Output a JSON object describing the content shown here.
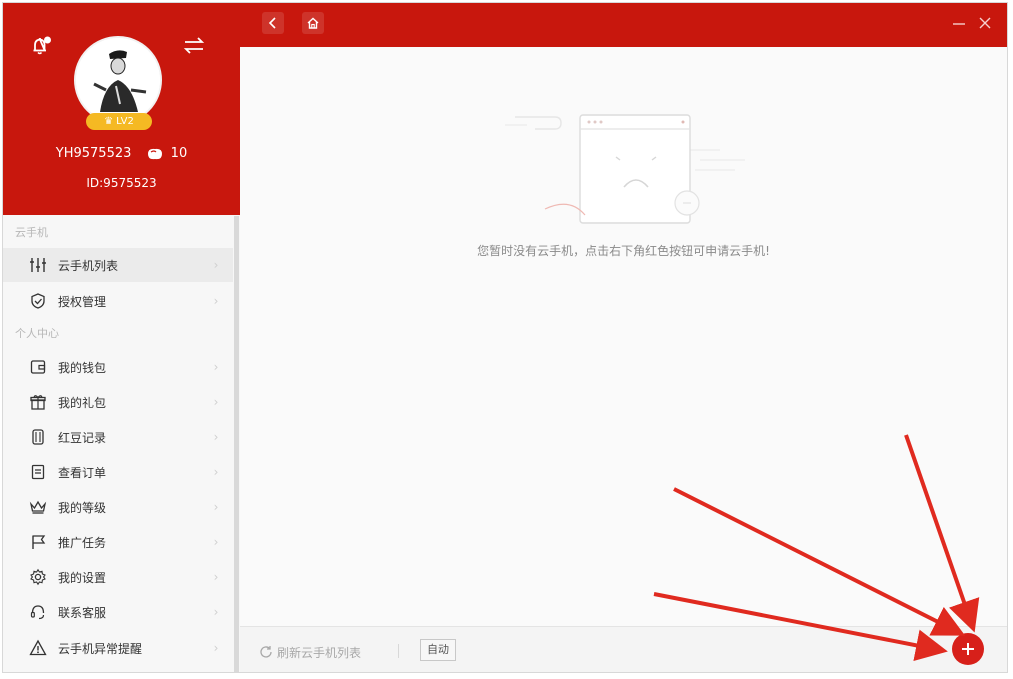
{
  "colors": {
    "brand_red": "#c8170d",
    "badge_gold": "#f5b923",
    "fab_red": "#d7201a"
  },
  "profile": {
    "username": "YH9575523",
    "bean_count": "10",
    "user_id": "ID:9575523",
    "level": "LV2"
  },
  "sidebar": {
    "section_cloud": "云手机",
    "cloud_items": [
      {
        "label": "云手机列表",
        "icon": "sliders-icon"
      },
      {
        "label": "授权管理",
        "icon": "shield-check-icon"
      }
    ],
    "section_personal": "个人中心",
    "personal_items": [
      {
        "label": "我的钱包",
        "icon": "wallet-icon"
      },
      {
        "label": "我的礼包",
        "icon": "gift-icon"
      },
      {
        "label": "红豆记录",
        "icon": "bean-record-icon"
      },
      {
        "label": "查看订单",
        "icon": "order-icon"
      },
      {
        "label": "我的等级",
        "icon": "crown-icon"
      },
      {
        "label": "推广任务",
        "icon": "flag-icon"
      },
      {
        "label": "我的设置",
        "icon": "gear-icon"
      },
      {
        "label": "联系客服",
        "icon": "headset-icon"
      },
      {
        "label": "云手机异常提醒",
        "icon": "warning-icon"
      }
    ]
  },
  "main": {
    "empty_message": "您暂时没有云手机，点击右下角红色按钮可申请云手机!"
  },
  "bottom": {
    "refresh_label": "刷新云手机列表",
    "auto_label": "自动"
  }
}
